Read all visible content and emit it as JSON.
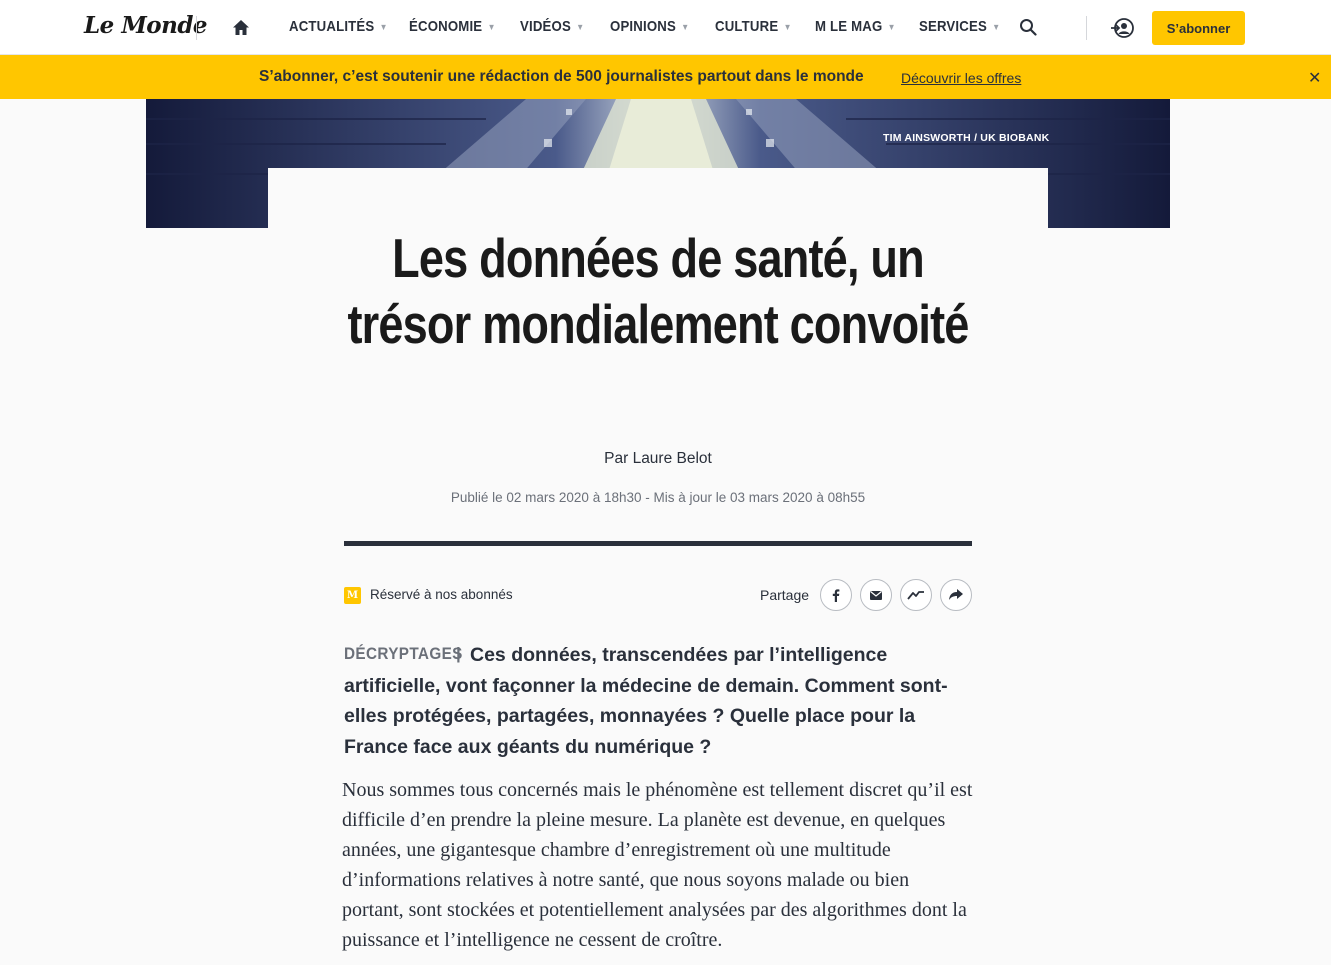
{
  "header": {
    "logo": "Le Monde",
    "nav": [
      {
        "label": "ACTUALITÉS",
        "has_menu": true
      },
      {
        "label": "ÉCONOMIE",
        "has_menu": true
      },
      {
        "label": "VIDÉOS",
        "has_menu": true
      },
      {
        "label": "OPINIONS",
        "has_menu": true
      },
      {
        "label": "CULTURE",
        "has_menu": true
      },
      {
        "label": "M LE MAG",
        "has_menu": true
      },
      {
        "label": "SERVICES",
        "has_menu": true
      }
    ],
    "subscribe_label": "S’abonner"
  },
  "banner": {
    "text": "S’abonner, c’est soutenir une rédaction de 500 journalistes partout dans le monde",
    "link": "Découvrir les offres"
  },
  "hero": {
    "credit": "TIM AINSWORTH / UK BIOBANK"
  },
  "article": {
    "title": "Les données de santé, un trésor mondialement convoité",
    "author": "Par Laure Belot",
    "dates": "Publié le 02 mars 2020 à 18h30 - Mis à jour le 03 mars 2020 à 08h55",
    "reserved_label": "Réservé à nos abonnés",
    "reserved_badge": "M",
    "share_label": "Partage",
    "kicker": "DÉCRYPTAGES",
    "kicker_sep": "|",
    "chapo": "Ces données, transcendées par l’intelligence artificielle, vont façonner la médecine de demain. Comment sont-elles protégées, partagées, monnayées ? Quelle place pour la France face aux géants du numérique ?",
    "body": "Nous sommes tous concernés mais le phénomène est tellement discret qu’il est difficile d’en prendre la pleine mesure. La planète est devenue, en quelques années, une gigantesque chambre d’enregistrement où une multitude d’informations relatives à notre santé, que nous soyons malade ou bien portant, sont stockées et potentiellement analysées par des algorithmes dont la puissance et l’intelligence ne cessent de croître."
  },
  "colors": {
    "brand_yellow": "#ffc600",
    "text_dark": "#2a303b",
    "text_muted": "#6b7079"
  },
  "icons": [
    "home-icon",
    "chevron-down-icon",
    "search-icon",
    "account-icon",
    "close-icon",
    "facebook-icon",
    "mail-icon",
    "messenger-icon",
    "share-arrow-icon"
  ]
}
